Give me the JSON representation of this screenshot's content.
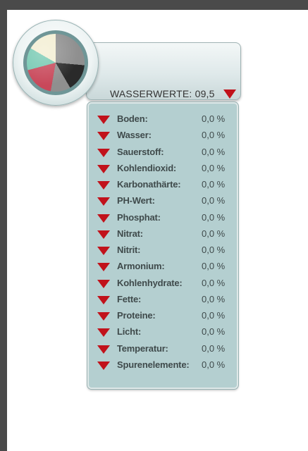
{
  "header": {
    "title": "WASSERWERTE: 09,5",
    "toggle_icon": "triangle-down-icon",
    "accent_color": "#c1121b"
  },
  "gauge": {
    "icon": "pie-chart-icon",
    "segment_colors": [
      "#2a2a2a",
      "#c8485a",
      "#76c9b2",
      "#f3eed2",
      "#8f8f8f"
    ]
  },
  "list": {
    "items": [
      {
        "label": "Boden:",
        "value": "0,0 %"
      },
      {
        "label": "Wasser:",
        "value": "0,0 %"
      },
      {
        "label": "Sauerstoff:",
        "value": "0,0 %"
      },
      {
        "label": "Kohlendioxid:",
        "value": "0,0 %"
      },
      {
        "label": "Karbonathärte:",
        "value": "0,0 %"
      },
      {
        "label": "PH-Wert:",
        "value": "0,0 %"
      },
      {
        "label": "Phosphat:",
        "value": "0,0 %"
      },
      {
        "label": "Nitrat:",
        "value": "0,0 %"
      },
      {
        "label": "Nitrit:",
        "value": "0,0 %"
      },
      {
        "label": "Armonium:",
        "value": "0,0 %"
      },
      {
        "label": "Kohlenhydrate:",
        "value": "0,0 %"
      },
      {
        "label": "Fette:",
        "value": "0,0 %"
      },
      {
        "label": "Proteine:",
        "value": "0,0 %"
      },
      {
        "label": "Licht:",
        "value": "0,0 %"
      },
      {
        "label": "Temperatur:",
        "value": "0,0 %"
      },
      {
        "label": "Spurenelemente:",
        "value": "0,0 %"
      }
    ]
  }
}
